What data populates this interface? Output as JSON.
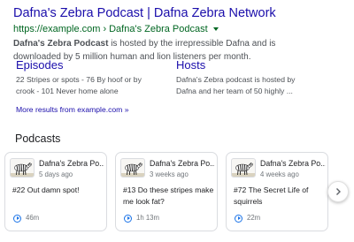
{
  "result": {
    "title": "Dafna's Zebra Podcast | Dafna Zebra Network",
    "url": "https://example.com",
    "url_separator": "›",
    "breadcrumb": "Dafna's Zebra Podcast",
    "snippet_bold": "Dafna's Zebra Podcast",
    "snippet_rest": " is hosted by the irrepressible Dafna and is downloaded by 5 million human and lion listeners per month."
  },
  "sitelinks": [
    {
      "title": "Episodes",
      "description": "22 Stripes or spots - 76 By hoof or by crook - 101 Never home alone"
    },
    {
      "title": "Hosts",
      "description": "Dafna's Zebra podcast is hosted by Dafna and her team of 50 highly ..."
    }
  ],
  "more_results": "More results from example.com »",
  "podcasts": {
    "heading": "Podcasts",
    "cards": [
      {
        "name": "Dafna's Zebra Po...",
        "date": "5 days ago",
        "episode": "#22 Out damn spot!",
        "duration": "46m"
      },
      {
        "name": "Dafna's Zebra Po...",
        "date": "3 weeks ago",
        "episode": "#13 Do these stripes make me look fat?",
        "duration": "1h 13m"
      },
      {
        "name": "Dafna's Zebra Po...",
        "date": "4 weeks ago",
        "episode": "#72 The Secret Life of squirrels",
        "duration": "22m"
      }
    ]
  },
  "icons": {
    "breadcrumb_menu": "caret-down-icon",
    "thumbnail": "zebra-thumbnail-icon",
    "play": "play-circle-icon",
    "next": "chevron-right-icon"
  },
  "colors": {
    "link": "#1a0dab",
    "url_green": "#006621",
    "snippet_text": "#4d5156",
    "meta_gray": "#70757a",
    "play_blue": "#1a73e8",
    "card_border": "#dadce0"
  }
}
